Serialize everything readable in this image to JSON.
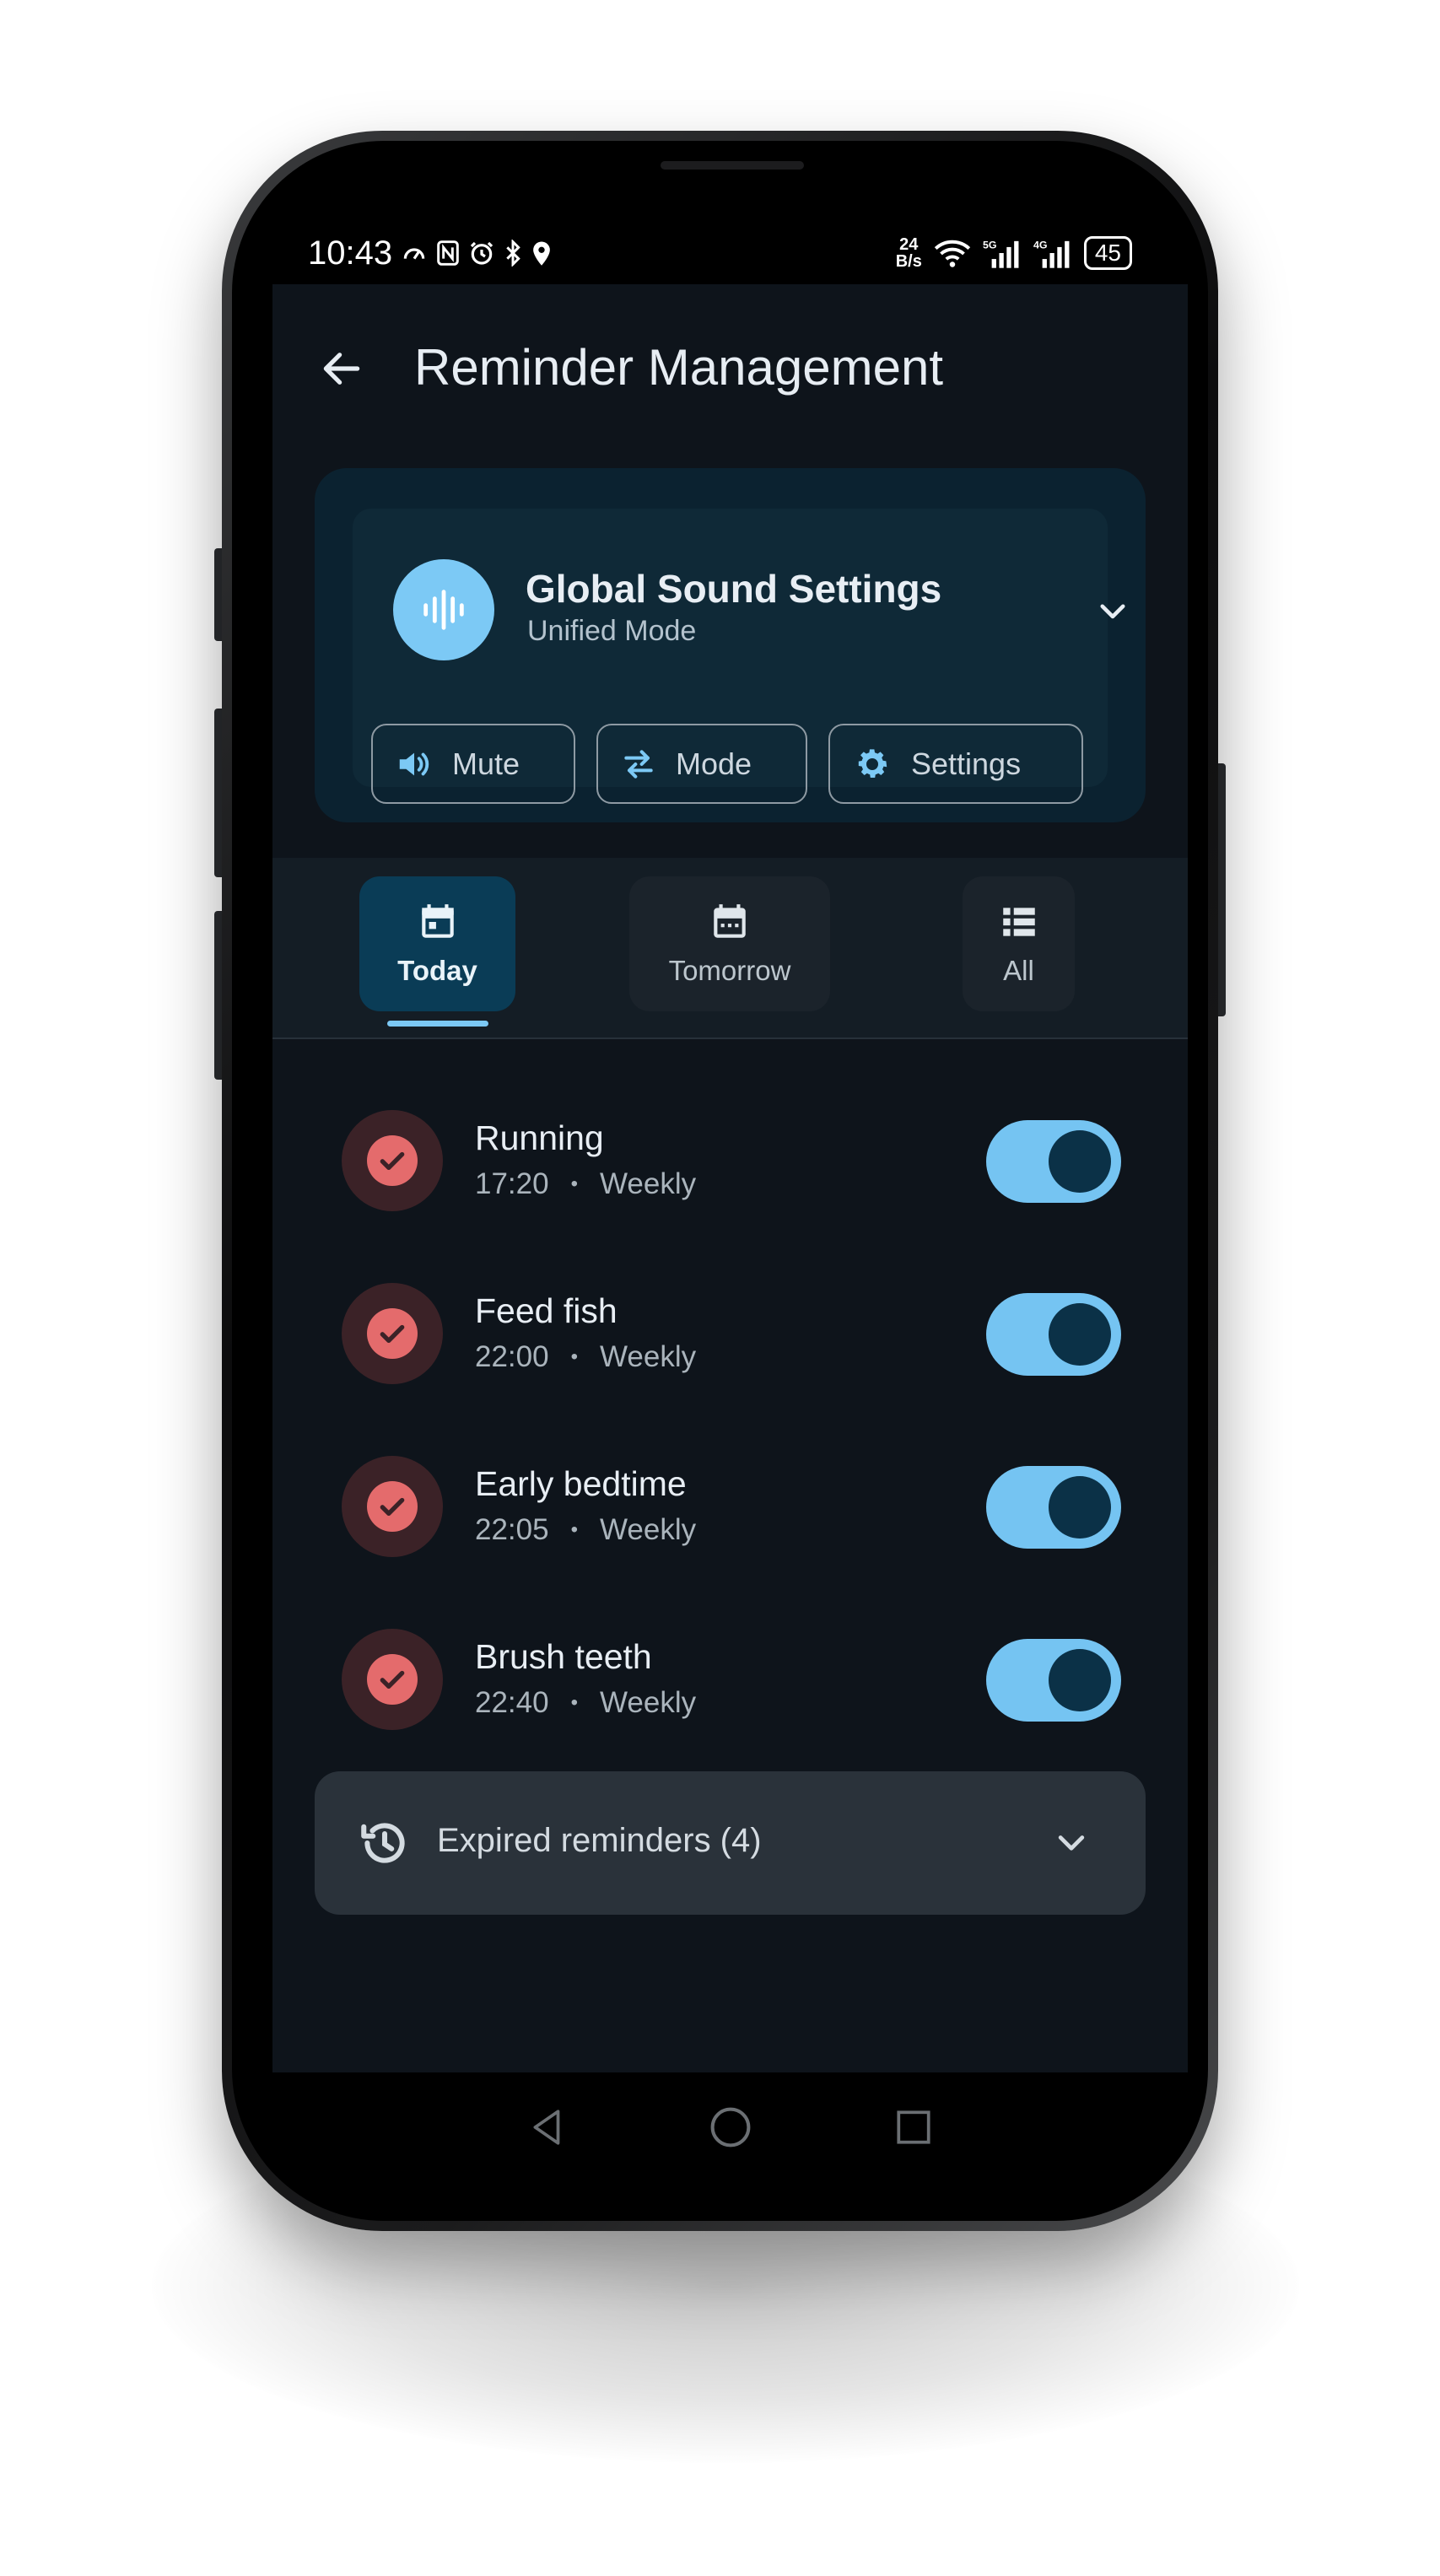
{
  "status_bar": {
    "time": "10:43",
    "net_rate_top": "24",
    "net_rate_bottom": "B/s",
    "battery": "45"
  },
  "app_bar": {
    "title": "Reminder Management"
  },
  "sound_card": {
    "title": "Global Sound Settings",
    "subtitle": "Unified Mode",
    "buttons": [
      {
        "label": "Mute",
        "icon": "volume-icon"
      },
      {
        "label": "Mode",
        "icon": "swap-icon"
      },
      {
        "label": "Settings",
        "icon": "gear-icon"
      }
    ]
  },
  "tabs": [
    {
      "label": "Today",
      "icon": "calendar-today-icon",
      "active": true
    },
    {
      "label": "Tomorrow",
      "icon": "calendar-icon",
      "active": false
    },
    {
      "label": "All",
      "icon": "list-icon",
      "active": false
    }
  ],
  "reminders": [
    {
      "name": "Running",
      "time": "17:20",
      "repeat": "Weekly",
      "enabled": true
    },
    {
      "name": "Feed fish",
      "time": "22:00",
      "repeat": "Weekly",
      "enabled": true
    },
    {
      "name": "Early bedtime",
      "time": "22:05",
      "repeat": "Weekly",
      "enabled": true
    },
    {
      "name": "Brush teeth",
      "time": "22:40",
      "repeat": "Weekly",
      "enabled": true
    }
  ],
  "expired": {
    "label": "Expired reminders (4)"
  },
  "colors": {
    "accent": "#75c4f2",
    "background": "#0e141b",
    "check": "#e46b6c"
  }
}
